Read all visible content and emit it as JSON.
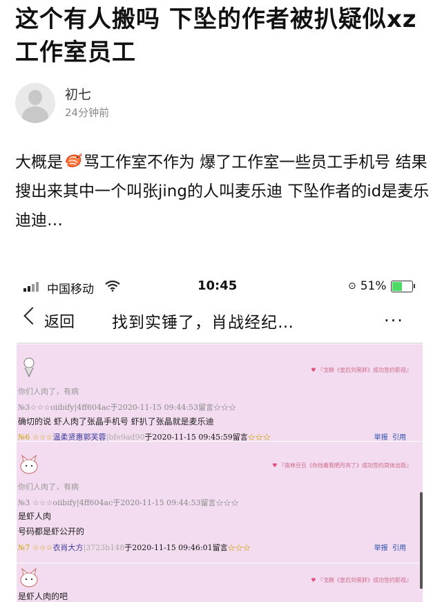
{
  "article": {
    "title": "这个有人搬吗 下坠的作者被扒疑似xz工作室员工",
    "author": "初七",
    "time": "24分钟前",
    "body_before": "大概是",
    "body_after": "骂工作室不作为 爆了工作室一些员工手机号 结果搜出来其中一个叫张jing的人叫麦乐迪 下坠作者的id是麦乐迪迪…"
  },
  "screenshot": {
    "carrier": "中国移动",
    "clock": "10:45",
    "battery": "51%",
    "back_label": "返回",
    "nav_title": "找到实锤了，肖战经纪…",
    "more": "···",
    "posts": [
      {
        "sig": "『戈鞅《皇后刘黑胖》成功签约影视』",
        "quote": "你们人肉了，有病",
        "meta": "№3☆☆☆oiibify|4ff604ac于2020-11-15 09:44:53留言☆☆☆",
        "lines": [
          "确切的说 虾人肉了张晶手机号 虾扒了张晶就是麦乐迪"
        ],
        "floor": "№6",
        "stars": "☆☆☆",
        "user": "温柔贤惠郭芙蓉",
        "fid": "|bfe9ad90",
        "when": "于2020-11-15 09:45:59留言",
        "stars_after": "☆☆☆",
        "report": "举报",
        "quote_btn": "引用"
      },
      {
        "sig": "『南林豆豆《你挡着我晒月亮了》成功签约简体出版』",
        "quote": "你们人肉了，有病",
        "meta": "№3 ☆☆☆oiibify|4ff604ac于2020-11-15 09:44:53留言☆☆☆",
        "lines": [
          "是虾人肉",
          "号码都是虾公开的"
        ],
        "floor": "№7",
        "stars": "☆☆☆",
        "user": "衣肖大方",
        "fid": "|3723b148",
        "when": "于2020-11-15 09:46:01留言",
        "stars_after": "☆☆☆",
        "report": "举报",
        "quote_btn": "引用"
      },
      {
        "sig": "『戈鞅《皇后刘黑胖》成功签约影视』",
        "lines": [
          "是虾人肉的吧"
        ]
      }
    ]
  },
  "colors": {
    "forum_bg": "#f3dcef",
    "signature": "#d06a8a",
    "username": "#3a3a9a",
    "stars": "#c9a200",
    "action_link": "#2a4fb0"
  },
  "icons": [
    "signal-icon",
    "wifi-icon",
    "battery-icon",
    "back-chevron-icon",
    "more-icon",
    "shrimp-emoji-icon",
    "avatar-placeholder-icon"
  ]
}
